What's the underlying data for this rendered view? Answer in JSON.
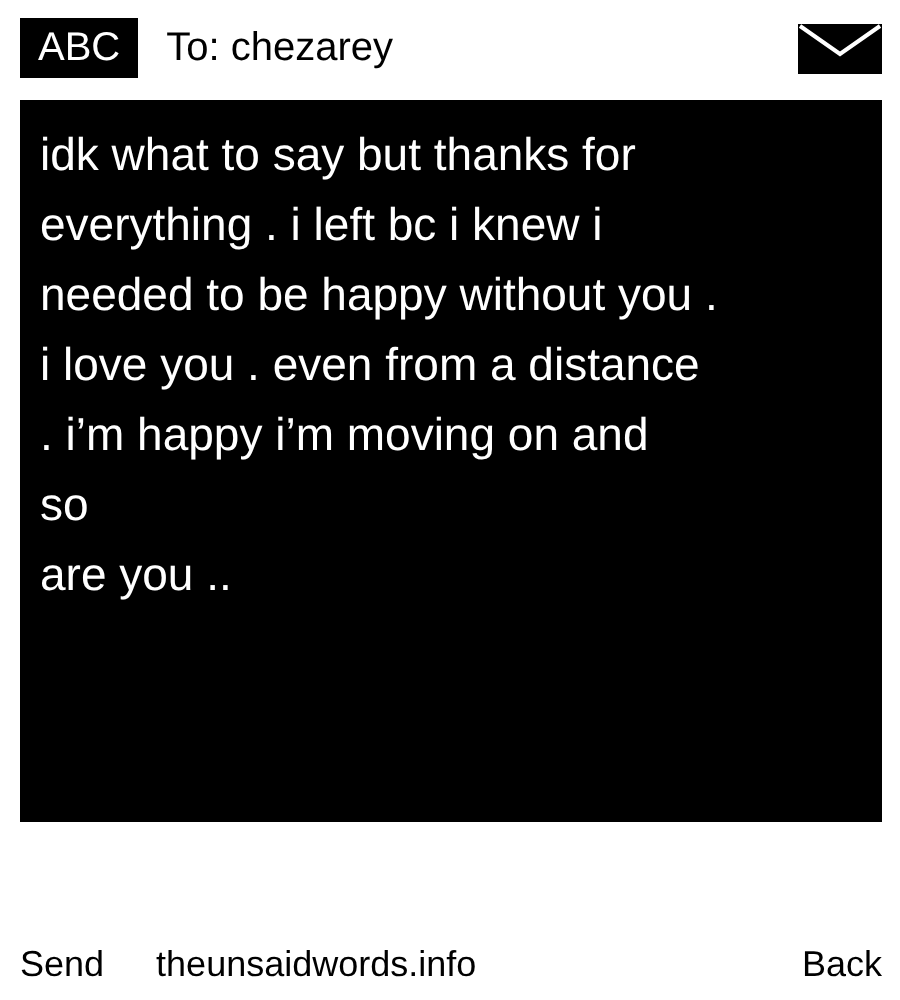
{
  "header": {
    "mode": "ABC",
    "recipient": "To: chezarey"
  },
  "message": {
    "lines": [
      "idk what to say but thanks for",
      "everything . i left bc i knew i",
      "needed to be happy without you .",
      "i love you . even from a distance",
      ". i’m happy i’m moving on and",
      "so",
      "are you .."
    ]
  },
  "softkeys": {
    "left": "Send",
    "center": "theunsaidwords.info",
    "right": "Back"
  }
}
